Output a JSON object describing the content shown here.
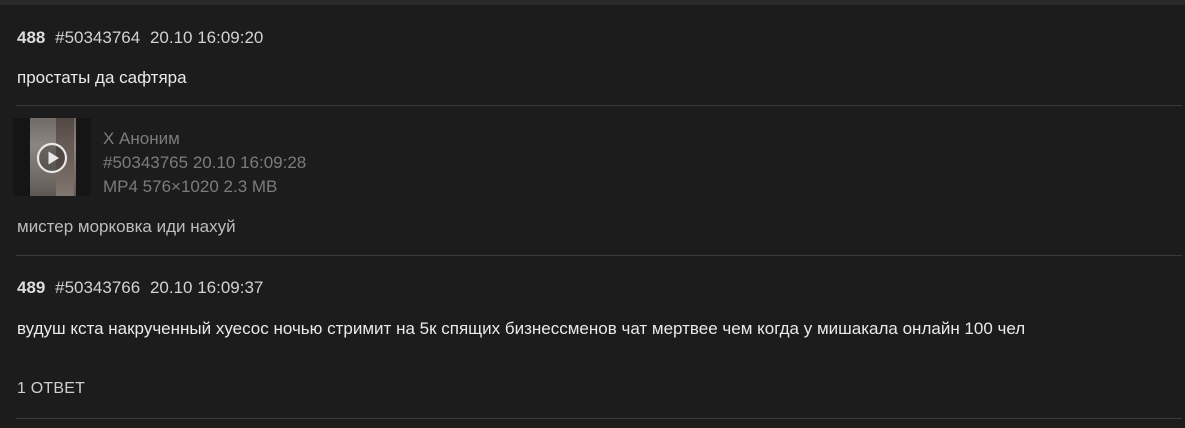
{
  "posts": [
    {
      "number": "488",
      "id": "#50343764",
      "datetime": "20.10 16:09:20",
      "text": "простаты да сафтяра"
    },
    {
      "name": "X Аноним",
      "id_datetime": "#50343765 20.10 16:09:28",
      "file_info": "MP4 576×1020 2.3 MB",
      "text": "мистер морковка иди нахуй"
    },
    {
      "number": "489",
      "id": "#50343766",
      "datetime": "20.10 16:09:37",
      "text": "вудуш кста накрученный хуесос ночью стримит на 5к спящих бизнессменов чат мертвее чем когда у мишакала онлайн 100 чел",
      "replies": "1 ОТВЕТ"
    }
  ],
  "icons": {
    "play": "play-icon"
  },
  "colors": {
    "background": "#1c1c1c",
    "divider": "#3a3a3a",
    "muted_text": "#7c7c7c"
  }
}
